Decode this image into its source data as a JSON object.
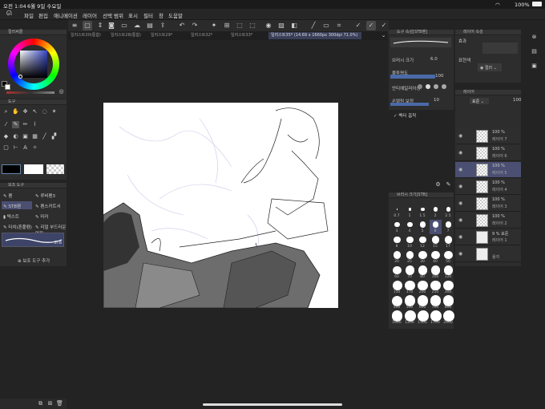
{
  "status": {
    "time": "오전 1:04",
    "date": "6월 9일 수요일",
    "battery": "100%"
  },
  "menu": [
    "파일",
    "편집",
    "애니메이션",
    "레이어",
    "선택 범위",
    "표시",
    "필터",
    "창",
    "도움말"
  ],
  "tabs": [
    "일러스트30(통합)",
    "일러스트28(통합)",
    "일러스트29*",
    "일러스트32*",
    "일러스트33*",
    "일러스트35* (14.69 x 1660px 300dpi 71.0%)"
  ],
  "color_panel": {
    "title": "컬러써클"
  },
  "tool_panel": {
    "title": "도구"
  },
  "sub_tool_panel": {
    "title": "보조 도구",
    "items": [
      "펜",
      "루비펜3",
      "STB펜",
      "펜스커트서",
      "텍스트",
      "마커",
      "타치(혼풀펜)",
      "리얼 부드러운연필"
    ],
    "selected_brush": "STB",
    "add_label": "보조 도구 추가"
  },
  "tool_props": {
    "title": "도구 속성[STB펜]",
    "brush_size_label": "브러시 크기",
    "brush_size": "6.0",
    "opacity_label": "불투명도",
    "opacity": "100",
    "anti_alias_label": "안티에일리어싱",
    "stabilization_label": "손떨림 보정",
    "stabilization": "10",
    "vector_label": "벡터 흡착"
  },
  "brush_size_panel": {
    "title": "브러시 크기[STB]",
    "sizes": [
      "0.7",
      "1",
      "1.5",
      "2",
      "2.5",
      "3",
      "4",
      "5",
      "6",
      "7",
      "8",
      "10",
      "12",
      "15",
      "17",
      "20",
      "25",
      "30",
      "40",
      "50",
      "60",
      "70",
      "80",
      "100",
      "120",
      "150",
      "170",
      "200",
      "250",
      "300",
      "400",
      "500",
      "600",
      "700",
      "800",
      "1000",
      "1200",
      "1500",
      "1700",
      "2000"
    ],
    "selected": "6"
  },
  "layer_props": {
    "title": "레이어 속성",
    "effect_label": "효과",
    "color_label": "표현색",
    "color_value": "컬러"
  },
  "layer_panel": {
    "title": "레이어",
    "blend": "표준",
    "opacity": "100",
    "layers": [
      {
        "pct": "100 %",
        "name": "레이어 7"
      },
      {
        "pct": "100 %",
        "name": "레이어 6"
      },
      {
        "pct": "100 %",
        "name": "레이어 5"
      },
      {
        "pct": "100 %",
        "name": "레이어 4"
      },
      {
        "pct": "100 %",
        "name": "레이어 3"
      },
      {
        "pct": "100 %",
        "name": "레이어 2"
      },
      {
        "pct": "9 % 표준",
        "name": "레이어 1"
      },
      {
        "pct": "",
        "name": "용지"
      }
    ],
    "selected_index": 2
  }
}
